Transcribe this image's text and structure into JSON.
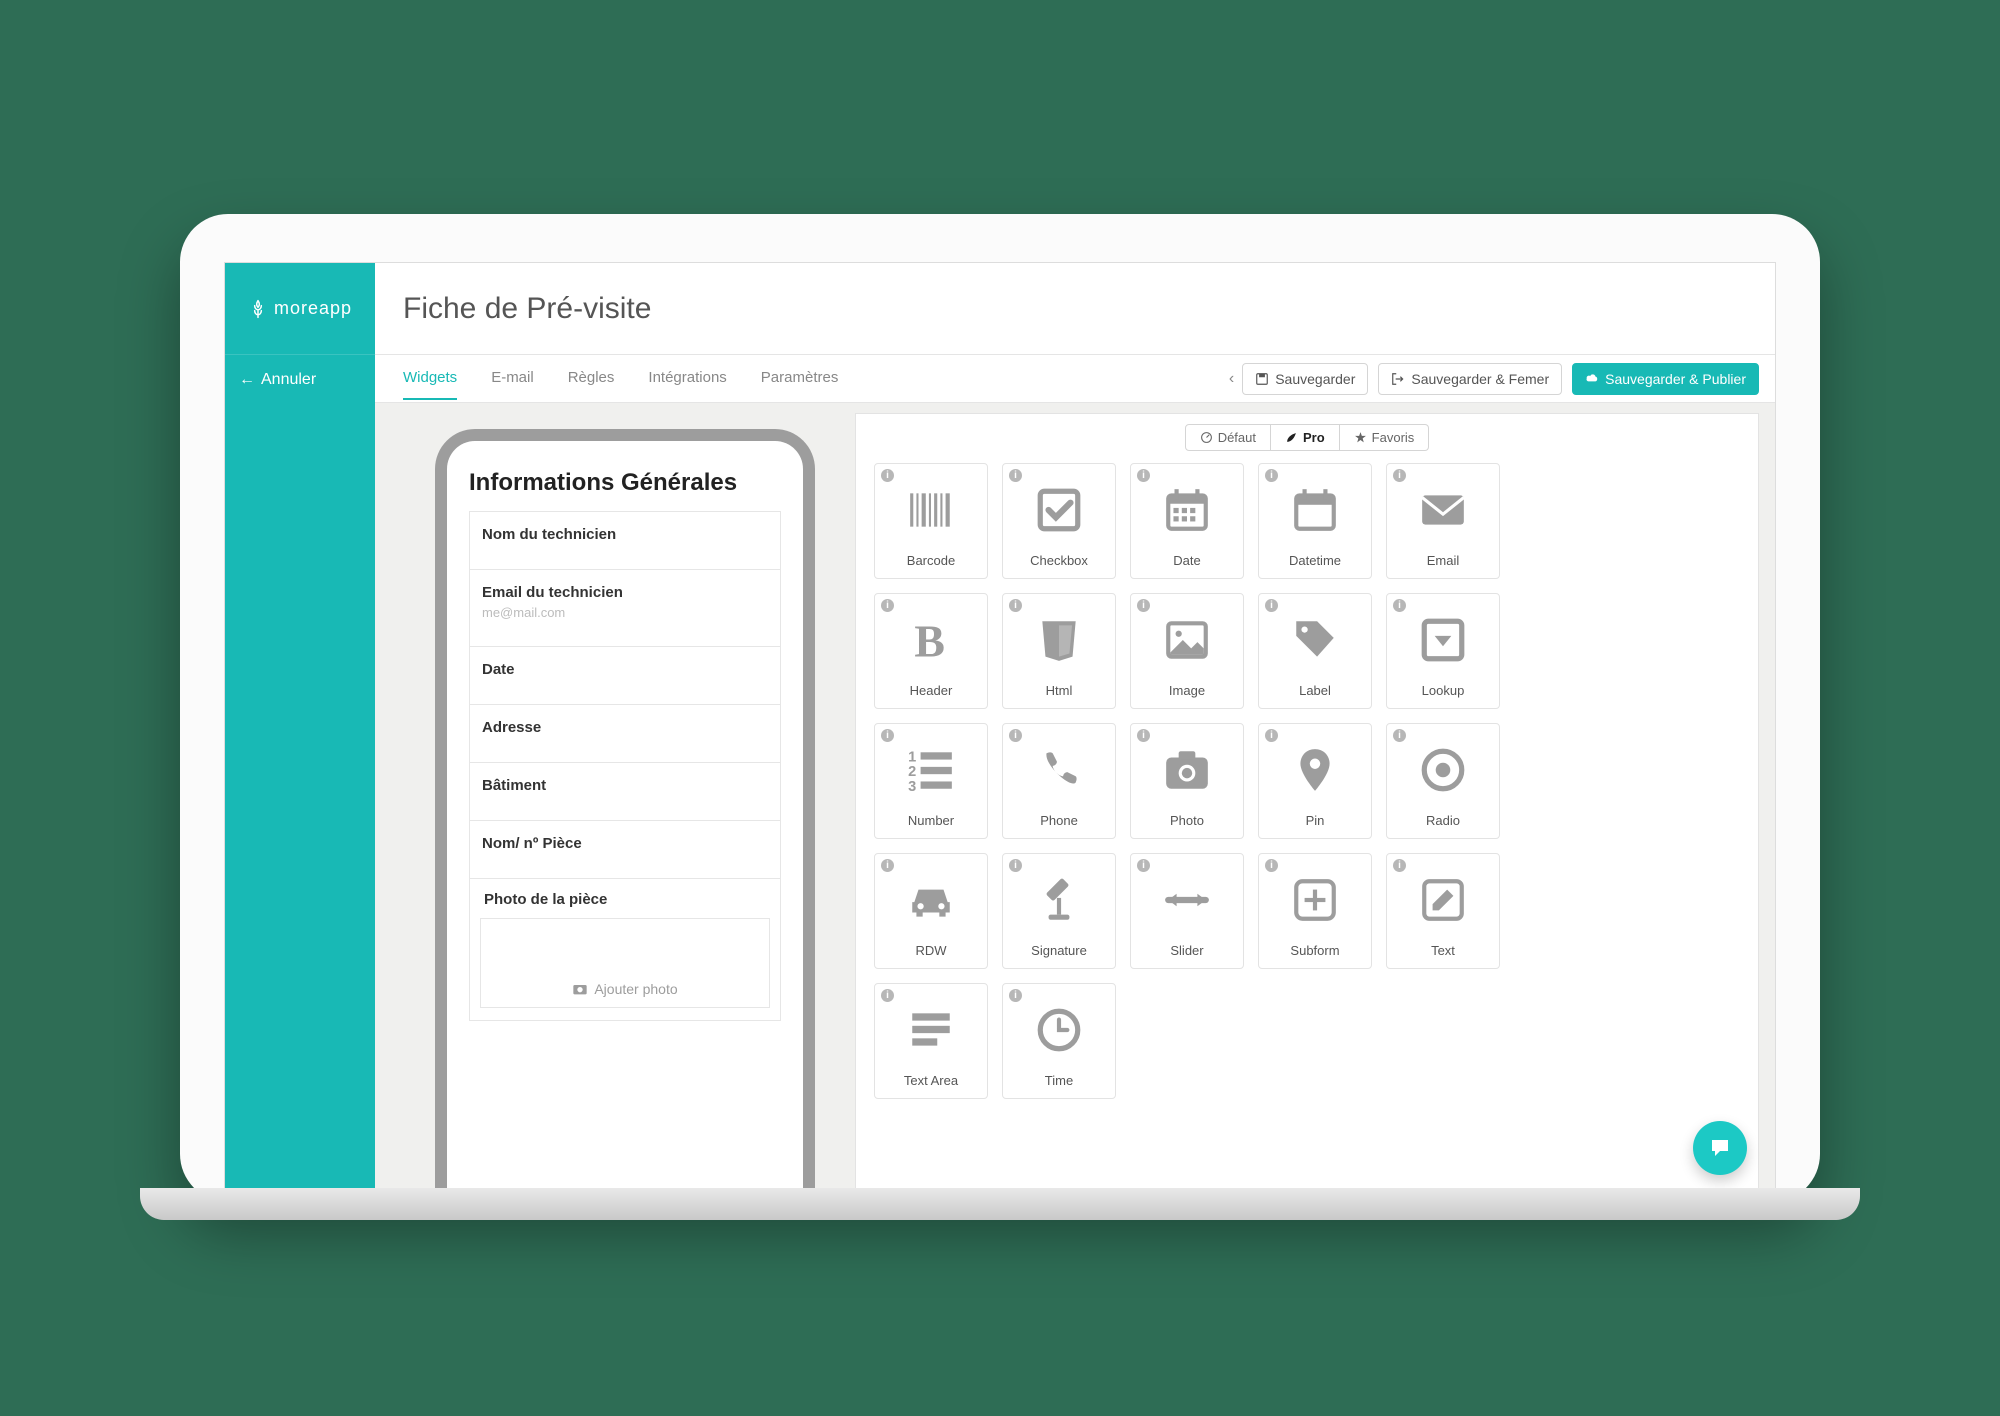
{
  "brand": "moreapp",
  "sidebar": {
    "back_label": "Annuler"
  },
  "header": {
    "title": "Fiche de Pré-visite"
  },
  "tabs": [
    "Widgets",
    "E-mail",
    "Règles",
    "Intégrations",
    "Paramètres"
  ],
  "active_tab": 0,
  "actions": {
    "save": "Sauvegarder",
    "save_close": "Sauvegarder & Femer",
    "save_publish": "Sauvegarder & Publier"
  },
  "preview": {
    "title": "Informations Générales",
    "fields": [
      {
        "label": "Nom du technicien",
        "placeholder": ""
      },
      {
        "label": "Email du technicien",
        "placeholder": "me@mail.com"
      },
      {
        "label": "Date",
        "placeholder": ""
      },
      {
        "label": "Adresse",
        "placeholder": ""
      },
      {
        "label": "Bâtiment",
        "placeholder": ""
      },
      {
        "label": "Nom/ nº Pièce",
        "placeholder": ""
      }
    ],
    "photo_label": "Photo de la pièce",
    "add_photo": "Ajouter photo"
  },
  "widget_tabs": [
    {
      "label": "Défaut",
      "icon": "dashboard"
    },
    {
      "label": "Pro",
      "icon": "leaf"
    },
    {
      "label": "Favoris",
      "icon": "star"
    }
  ],
  "active_widget_tab": 1,
  "widgets": [
    {
      "name": "Barcode",
      "icon": "barcode"
    },
    {
      "name": "Checkbox",
      "icon": "checkbox"
    },
    {
      "name": "Date",
      "icon": "calendar-grid"
    },
    {
      "name": "Datetime",
      "icon": "calendar"
    },
    {
      "name": "Email",
      "icon": "envelope"
    },
    {
      "name": "Header",
      "icon": "bold"
    },
    {
      "name": "Html",
      "icon": "html5"
    },
    {
      "name": "Image",
      "icon": "image"
    },
    {
      "name": "Label",
      "icon": "tag"
    },
    {
      "name": "Lookup",
      "icon": "dropdown"
    },
    {
      "name": "Number",
      "icon": "number-list"
    },
    {
      "name": "Phone",
      "icon": "phone"
    },
    {
      "name": "Photo",
      "icon": "camera"
    },
    {
      "name": "Pin",
      "icon": "pin"
    },
    {
      "name": "Radio",
      "icon": "radio"
    },
    {
      "name": "RDW",
      "icon": "car"
    },
    {
      "name": "Signature",
      "icon": "gavel"
    },
    {
      "name": "Slider",
      "icon": "slider"
    },
    {
      "name": "Subform",
      "icon": "plus-square"
    },
    {
      "name": "Text",
      "icon": "edit"
    },
    {
      "name": "Text Area",
      "icon": "text-lines"
    },
    {
      "name": "Time",
      "icon": "clock"
    }
  ]
}
